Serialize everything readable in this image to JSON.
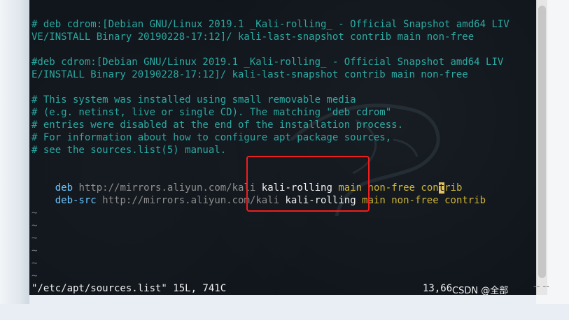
{
  "terminal": {
    "lines": [
      {
        "text": "# deb cdrom:[Debian GNU/Linux 2019.1 _Kali-rolling_ - Official Snapshot amd64 LIV"
      },
      {
        "text": "VE/INSTALL Binary 20190228-17:12]/ kali-last-snapshot contrib main non-free"
      },
      {
        "text": "#deb cdrom:[Debian GNU/Linux 2019.1 _Kali-rolling_ - Official Snapshot amd64 LIV"
      },
      {
        "text": "E/INSTALL Binary 20190228-17:12]/ kali-last-snapshot contrib main non-free"
      },
      {
        "text": "# This system was installed using small removable media"
      },
      {
        "text": "# (e.g. netinst, live or single CD). The matching \"deb cdrom\""
      },
      {
        "text": "# entries were disabled at the end of the installation process."
      },
      {
        "text": "# For information about how to configure apt package sources,"
      },
      {
        "text": "# see the sources.list(5) manual."
      }
    ],
    "deb_line": {
      "keyword": "deb",
      "url": "http://mirrors.aliyun.com/kali",
      "rest_1": "kali-rolling",
      "rest_2": "main",
      "rest_3": "non-free",
      "rest_4a": "con",
      "cursor": "t",
      "rest_4b": "rib"
    },
    "debsrc_line": {
      "keyword": "deb-src",
      "url": "http://mirrors.aliyun.com/kali",
      "rest_1": "kali-rolling",
      "rest_2": "main",
      "rest_3": "non-free contrib"
    },
    "tildes": [
      "~",
      "~",
      "~",
      "~",
      "~",
      "~"
    ],
    "status_left": "\"/etc/apt/sources.list\" 15L, 741C",
    "status_right": "13,66"
  },
  "watermark": "CSDN @全部",
  "watermark_suffix": "-- --",
  "colors": {
    "comment": "#28a8a1",
    "keyword": "#6bc4ff",
    "url": "#8c8c8c",
    "highlight": "#f21d1d"
  }
}
